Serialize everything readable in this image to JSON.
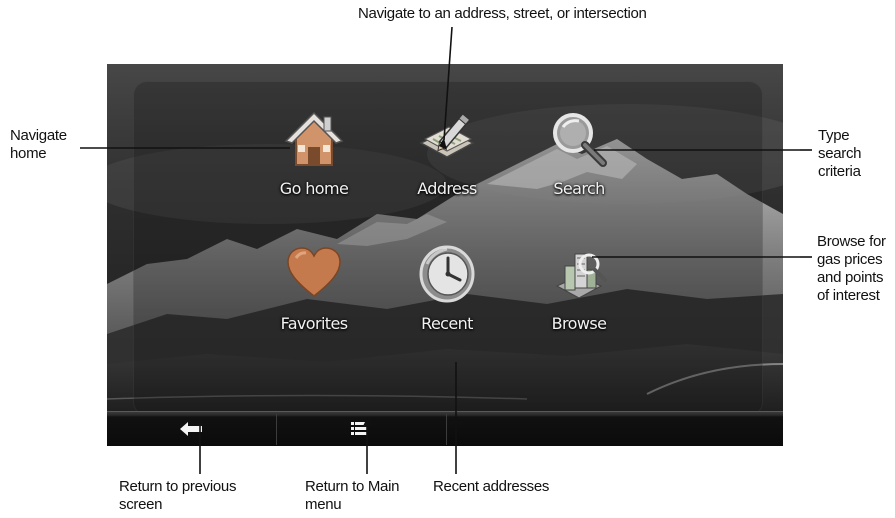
{
  "callouts": {
    "address": "Navigate to an address, street, or intersection",
    "home_line1": "Navigate",
    "home_line2": "home",
    "search_line1": "Type",
    "search_line2": "search",
    "search_line3": "criteria",
    "browse_line1": "Browse for",
    "browse_line2": "gas prices",
    "browse_line3": "and points",
    "browse_line4": "of interest",
    "back_line1": "Return to previous",
    "back_line2": "screen",
    "main_line1": "Return to Main",
    "main_line2": "menu",
    "recent": "Recent addresses"
  },
  "menu": {
    "go_home": "Go home",
    "address": "Address",
    "search": "Search",
    "favorites": "Favorites",
    "recent": "Recent",
    "browse": "Browse"
  },
  "icons": {
    "go_home": "house-icon",
    "address": "pencil-paper-icon",
    "search": "magnifier-icon",
    "favorites": "heart-icon",
    "recent": "clock-icon",
    "browse": "buildings-magnifier-icon",
    "back": "back-arrow-icon",
    "main_menu": "list-menu-icon"
  },
  "colors": {
    "label_text": "#f2f2f2",
    "house_orange": "#c98b5a",
    "heart_orange": "#c77a4b"
  }
}
